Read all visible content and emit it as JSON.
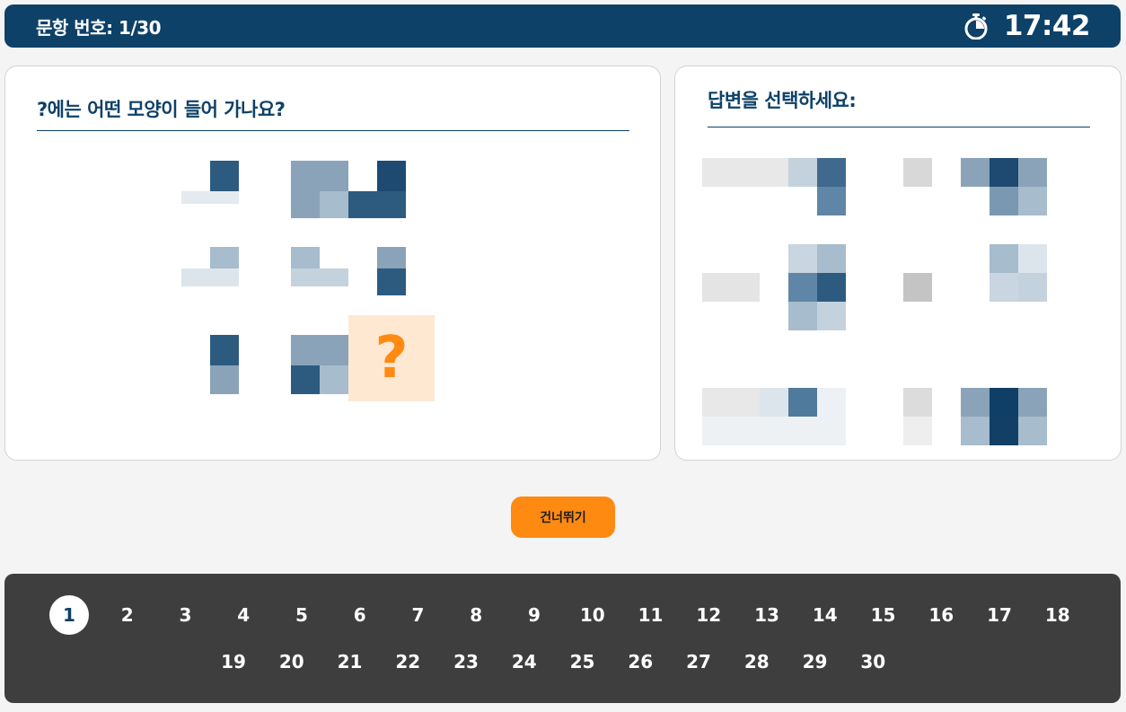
{
  "header": {
    "question_number": "문항 번호: 1/30",
    "timer": "17:42"
  },
  "question": {
    "prompt": "?에는 어떤 모양이 들어 가나요?",
    "missing_symbol": "?"
  },
  "answers": {
    "prompt": "답변을 선택하세요:"
  },
  "skip_label": "건너뛰기",
  "navigation": {
    "row1": [
      "1",
      "2",
      "3",
      "4",
      "5",
      "6",
      "7",
      "8",
      "9",
      "10",
      "11",
      "12",
      "13",
      "14",
      "15",
      "16",
      "17",
      "18"
    ],
    "row2": [
      "19",
      "20",
      "21",
      "22",
      "23",
      "24",
      "25",
      "26",
      "27",
      "28",
      "29",
      "30"
    ],
    "current": "1"
  },
  "colors": {
    "primary": "#0d4168",
    "accent": "#ff8a12",
    "nav_background": "#3e3e3e",
    "page_background": "#f4f4f4"
  }
}
